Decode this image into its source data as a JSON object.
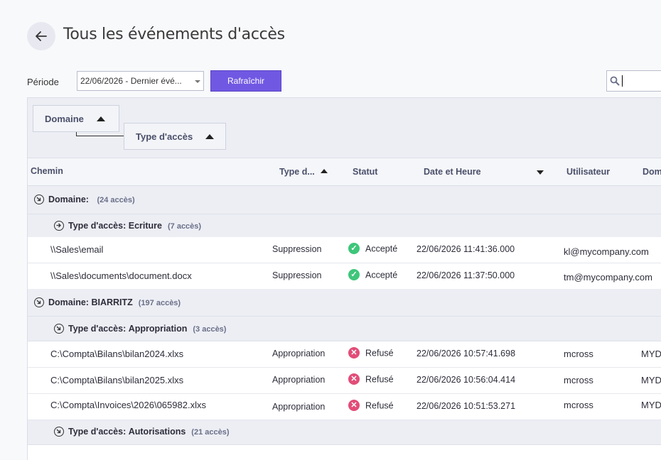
{
  "page": {
    "title": "Tous les événements d'accès"
  },
  "toolbar": {
    "period_label": "Période",
    "period_value": "22/06/2026 - Dernier évé...",
    "refresh_label": "Rafraîchir"
  },
  "grouping": {
    "chip1": "Domaine",
    "chip2": "Type d'accès"
  },
  "columns": {
    "path": "Chemin",
    "type": "Type d...",
    "status": "Statut",
    "datetime": "Date et Heure",
    "user": "Utilisateur",
    "domain": "Dom"
  },
  "groups": {
    "g1": {
      "label": "Domaine:",
      "value": "",
      "count": "(24 accès)"
    },
    "g1a": {
      "label": "Type d'accès:",
      "value": "Ecriture",
      "count": "(7 accès)"
    },
    "g2": {
      "label": "Domaine:",
      "value": "BIARRITZ",
      "count": "(197 accès)"
    },
    "g2a": {
      "label": "Type d'accès:",
      "value": "Appropriation",
      "count": "(3 accès)"
    },
    "g2b": {
      "label": "Type d'accès:",
      "value": "Autorisations",
      "count": "(21 accès)"
    }
  },
  "rows": [
    {
      "path": "\\\\Sales\\email",
      "type": "Suppression",
      "status": "Accepté",
      "datetime": "22/06/2026 11:41:36.000",
      "user": "kl@mycompany.com",
      "domain": ""
    },
    {
      "path": "\\\\Sales\\documents\\document.docx",
      "type": "Suppression",
      "status": "Accepté",
      "datetime": "22/06/2026 11:37:50.000",
      "user": "tm@mycompany.com",
      "domain": ""
    },
    {
      "path": "C:\\Compta\\Bilans\\bilan2024.xlxs",
      "type": "Appropriation",
      "status": "Refusé",
      "datetime": "22/06/2026 10:57:41.698",
      "user": "mcross",
      "domain": "MYD"
    },
    {
      "path": "C:\\Compta\\Bilans\\bilan2025.xlxs",
      "type": "Appropriation",
      "status": "Refusé",
      "datetime": "22/06/2026 10:56:04.414",
      "user": "mcross",
      "domain": "MYD"
    },
    {
      "path": "C:\\Compta\\Invoices\\2026\\065982.xlxs",
      "type": "Appropriation",
      "status": "Refusé",
      "datetime": "22/06/2026 10:51:53.271",
      "user": "mcross",
      "domain": "MYD"
    }
  ],
  "icons": {
    "back": "arrow-left-icon",
    "search": "search-icon",
    "group_collapse": "arrow-down-right-icon",
    "subgroup_collapse": "arrow-right-icon",
    "accepted": "check-circle-icon",
    "refused": "x-circle-icon"
  },
  "colors": {
    "accent": "#7158e2",
    "accepted": "#3ec67a",
    "refused": "#e24d78"
  }
}
